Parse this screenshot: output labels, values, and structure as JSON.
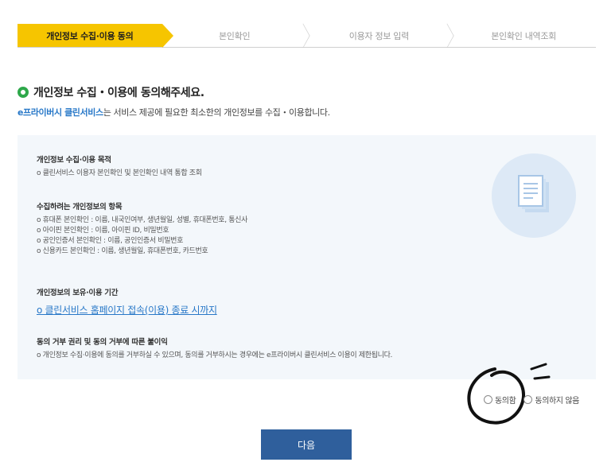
{
  "steps": [
    {
      "label": "개인정보 수집·이용 동의",
      "active": true
    },
    {
      "label": "본인확인",
      "active": false
    },
    {
      "label": "이용자 정보 입력",
      "active": false
    },
    {
      "label": "본인확인 내역조회",
      "active": false
    }
  ],
  "heading": "개인정보 수집・이용에 동의해주세요.",
  "subtext": {
    "brand": "e프라이버시 클린서비스",
    "rest": "는 서비스 제공에 필요한 최소한의 개인정보를 수집・이용합니다."
  },
  "sections": {
    "purpose": {
      "title": "개인정보 수집·이용 목적",
      "lines": [
        "o 클린서비스 이용자 본인확인 및 본인확인 내역 통합 조회"
      ]
    },
    "items": {
      "title": "수집하려는 개인정보의 항목",
      "lines": [
        "o 휴대폰 본인확인 : 이름, 내국인여부, 생년월일, 성별, 휴대폰번호, 통신사",
        "o 아이핀 본인확인 : 이름, 아이핀 ID, 비밀번호",
        "o 공인인증서 본인확인 : 이름, 공인인증서 비밀번호",
        "o 신용카드 본인확인 : 이름, 생년월일, 휴대폰번호, 카드번호"
      ]
    },
    "retention": {
      "title": "개인정보의 보유·이용 기간",
      "link": "o 클린서비스 홈페이지 접속(이용) 종료 시까지"
    },
    "refusal": {
      "title": "동의 거부 권리 및 동의 거부에 따른 불이익",
      "lines": [
        "o 개인정보 수집·이용에 동의를 거부하실 수 있으며, 동의를 거부하시는 경우에는 e프라이버시 클린서비스 이용이 제한됩니다."
      ]
    }
  },
  "consent": {
    "agree_label": "동의함",
    "disagree_label": "동의하지 않음"
  },
  "next_label": "다음",
  "colors": {
    "active_step": "#f6c500",
    "brand": "#2878c8",
    "bullet": "#2ea84a",
    "button": "#2f5f9c",
    "box": "#f3f7fb"
  }
}
